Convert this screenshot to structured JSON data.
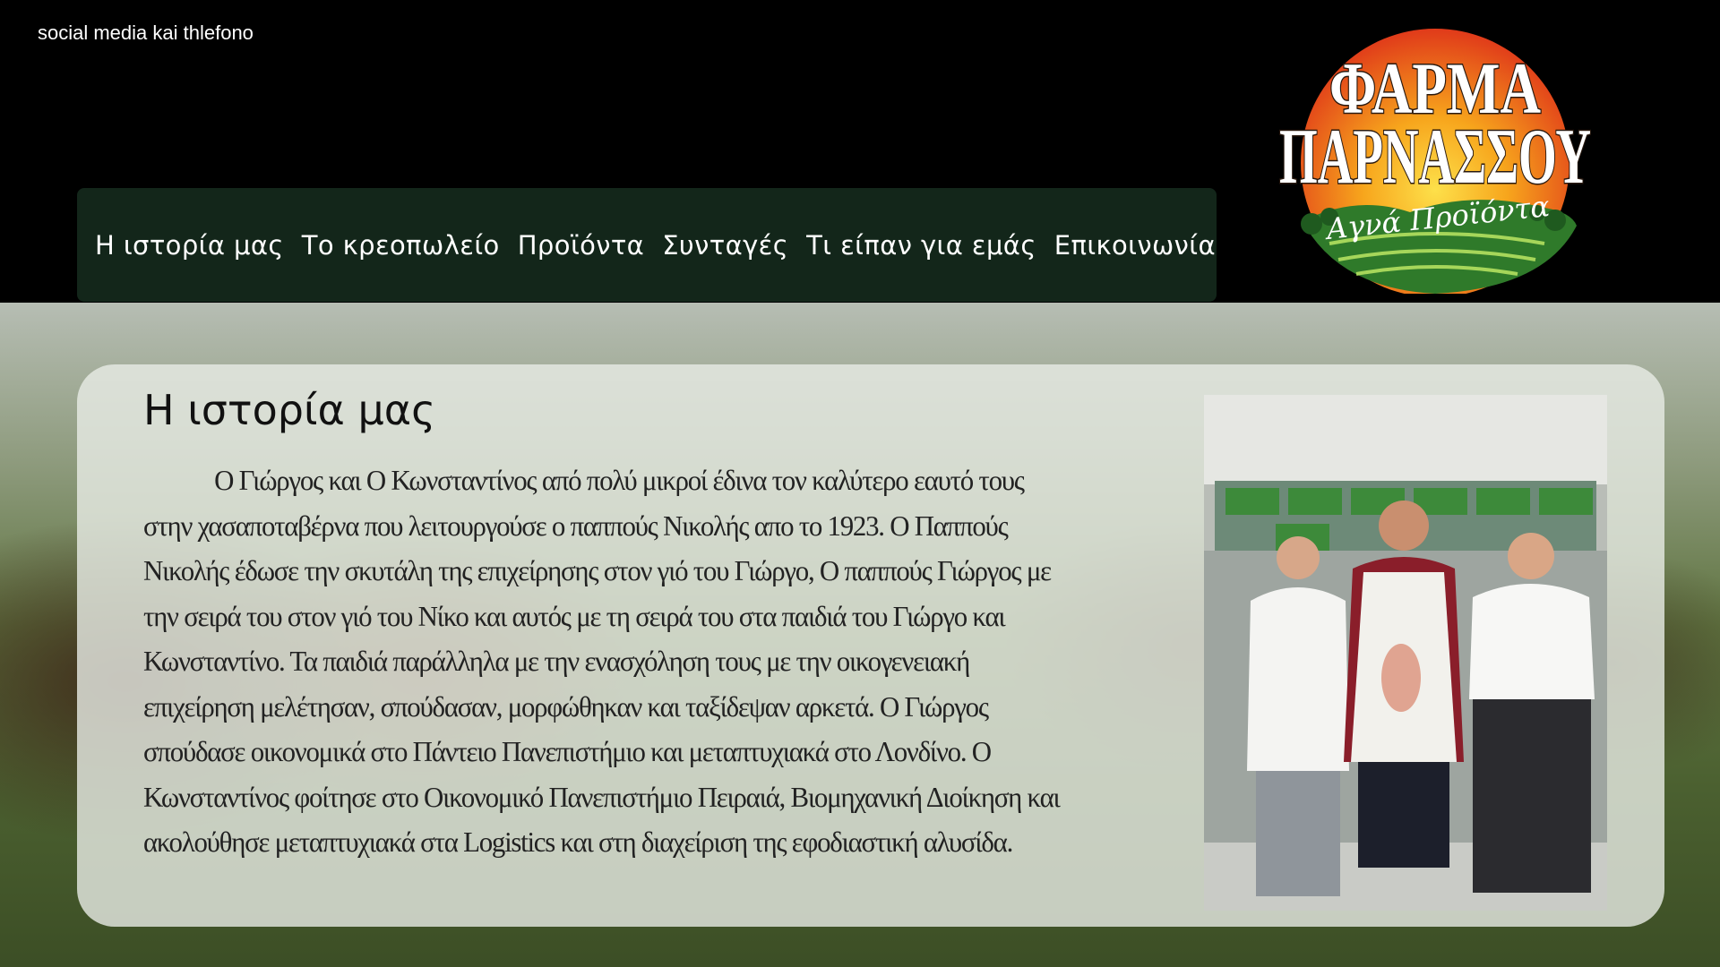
{
  "header": {
    "social_text": "social media kai thlefono",
    "logo": {
      "line1": "ΦΑΡΜΑ",
      "line2": "ΠΑΡΝΑΣΣΟΥ",
      "tagline": "Αγνά Προϊόντα"
    }
  },
  "nav": {
    "items": [
      {
        "label": "Η ιστορία μας"
      },
      {
        "label": "Το κρεοπωλείο"
      },
      {
        "label": "Προϊόντα"
      },
      {
        "label": "Συνταγές"
      },
      {
        "label": "Τι είπαν για εμάς"
      },
      {
        "label": "Επικοινωνία"
      }
    ]
  },
  "main": {
    "title": "Η ιστορία μας",
    "story": "Ο Γιώργος και Ο Κωνσταντίνος από πολύ μικροί έδινα τον καλύτερο εαυτό τους στην χασαποταβέρνα που λειτουργούσε ο παππούς Νικολής απο το 1923. Ο Παππούς Νικολής έδωσε την σκυτάλη της επιχείρησης στον γιό του Γιώργο, Ο παππούς Γιώργος με την σειρά του στον γιό του Νίκο και αυτός με τη σειρά του στα παιδιά του Γιώργο και Κωνσταντίνο. Τα παιδιά παράλληλα με την ενασχόληση τους με την οικογενειακή επιχείρηση μελέτησαν, σπούδασαν, μορφώθηκαν και ταξίδεψαν αρκετά. Ο Γιώργος σπούδασε οικονομικά στο Πάντειο Πανεπιστήμιο και μεταπτυχιακά στο Λονδίνο. Ο Κωνσταντίνος φοίτησε στο Οικονομικό Πανεπιστήμιο Πειραιά, Βιομηχανική Διοίκηση και ακολούθησε μεταπτυχιακά στα Logistics και στη διαχείριση της εφοδιαστική αλυσίδα."
  },
  "colors": {
    "header_bg": "#000000",
    "nav_bg": "#13261a",
    "logo_red": "#e03a1a",
    "logo_orange": "#f7a51c",
    "logo_green": "#2f7a2a"
  }
}
